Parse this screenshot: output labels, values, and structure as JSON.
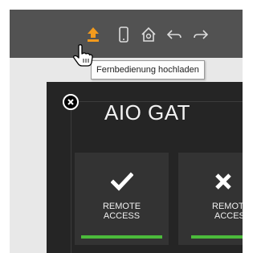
{
  "toolbar": {
    "icons": [
      "upload-icon",
      "phone-icon",
      "home-settings-icon",
      "undo-icon",
      "redo-icon"
    ],
    "accent_color": "#f29a1d"
  },
  "tooltip": {
    "text": "Fernbedienung hochladen"
  },
  "panel": {
    "title": "AIO GAT",
    "tiles": [
      {
        "icon": "checkmark-icon",
        "label_line1": "REMOTE",
        "label_line2": "ACCESS",
        "status_color": "#4cbb3c"
      },
      {
        "icon": "x-icon",
        "label_line1": "REMOT",
        "label_line2": "ACCES",
        "status_color": "#4cbb3c"
      }
    ]
  }
}
